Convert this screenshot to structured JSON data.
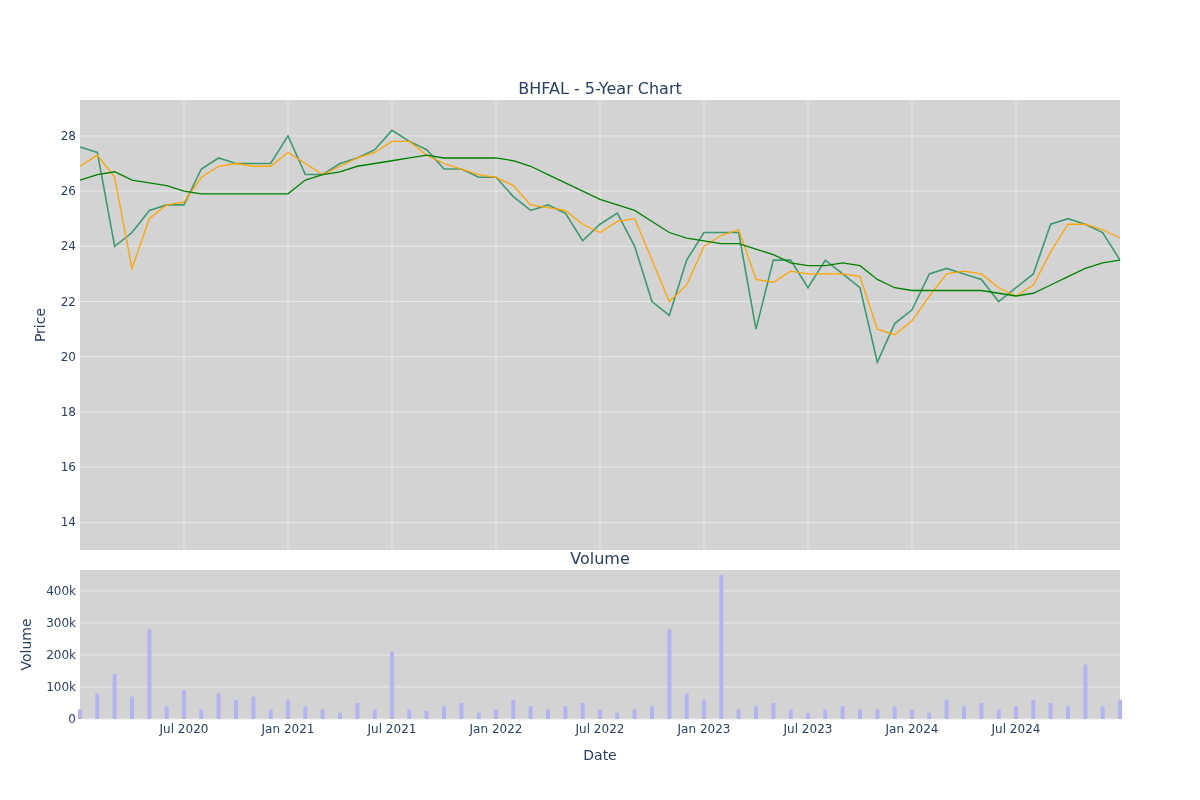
{
  "title": "BHFAL - 5-Year Chart",
  "price_chart": {
    "chart_data": {
      "type": "line",
      "ylabel": "Price",
      "grid": true,
      "ylim": [
        13,
        29.3
      ],
      "yticks": [
        {
          "value": 14,
          "label": "14"
        },
        {
          "value": 16,
          "label": "16"
        },
        {
          "value": 18,
          "label": "18"
        },
        {
          "value": 20,
          "label": "20"
        },
        {
          "value": 22,
          "label": "22"
        },
        {
          "value": 24,
          "label": "24"
        },
        {
          "value": 26,
          "label": "26"
        },
        {
          "value": 28,
          "label": "28"
        }
      ],
      "categories": [
        null,
        null,
        null,
        null,
        null,
        null,
        null,
        null,
        null,
        null,
        null,
        null,
        null,
        null,
        null,
        null,
        null,
        null,
        null,
        null,
        null,
        null,
        null,
        null,
        null,
        null,
        null,
        null,
        null,
        null,
        null,
        null,
        null,
        null,
        null,
        null,
        null,
        null,
        null,
        null,
        null,
        null,
        null,
        null,
        null,
        null,
        null,
        null,
        null,
        null,
        null,
        null,
        null,
        null,
        null,
        null,
        null,
        null,
        null,
        null,
        null
      ],
      "series": [
        {
          "color": "#3d9970",
          "values": [
            27.6,
            27.4,
            24,
            24.5,
            25.3,
            25.5,
            25.5,
            26.8,
            27.2,
            27,
            27,
            27,
            28,
            26.6,
            26.6,
            27,
            27.2,
            27.5,
            28.2,
            27.8,
            27.5,
            26.8,
            26.8,
            26.5,
            26.5,
            25.8,
            25.3,
            25.5,
            25.2,
            24.2,
            24.8,
            25.2,
            24,
            22,
            21.5,
            23.5,
            24.5,
            24.5,
            24.5,
            21,
            23.5,
            23.5,
            22.5,
            23.5,
            23,
            22.5,
            19.8,
            21.2,
            21.7,
            23,
            23.2,
            23,
            22.8,
            22,
            22.5,
            23,
            24.8,
            25,
            24.8,
            24.5,
            23.5
          ]
        },
        {
          "color": "#ffa500",
          "values": [
            26.9,
            27.3,
            26.5,
            23.2,
            25,
            25.5,
            25.6,
            26.5,
            26.9,
            27,
            26.9,
            26.9,
            27.4,
            27,
            26.6,
            26.9,
            27.2,
            27.4,
            27.8,
            27.8,
            27.3,
            27,
            26.8,
            26.6,
            26.5,
            26.2,
            25.5,
            25.4,
            25.3,
            24.8,
            24.5,
            24.9,
            25,
            23.5,
            22,
            22.6,
            24,
            24.4,
            24.6,
            22.8,
            22.7,
            23.1,
            23,
            23,
            23,
            22.9,
            21,
            20.8,
            21.3,
            22.2,
            23,
            23.1,
            23,
            22.5,
            22.2,
            22.6,
            23.8,
            24.8,
            24.8,
            24.6,
            24.3
          ]
        },
        {
          "color": "#008000",
          "values": [
            26.4,
            26.6,
            26.7,
            26.4,
            26.3,
            26.2,
            26,
            25.9,
            25.9,
            25.9,
            25.9,
            25.9,
            25.9,
            26.4,
            26.6,
            26.7,
            26.9,
            27,
            27.1,
            27.2,
            27.3,
            27.2,
            27.2,
            27.2,
            27.2,
            27.1,
            26.9,
            26.6,
            26.3,
            26,
            25.7,
            25.5,
            25.3,
            24.9,
            24.5,
            24.3,
            24.2,
            24.1,
            24.1,
            23.9,
            23.7,
            23.4,
            23.3,
            23.3,
            23.4,
            23.3,
            22.8,
            22.5,
            22.4,
            22.4,
            22.4,
            22.4,
            22.4,
            22.3,
            22.2,
            22.3,
            22.6,
            22.9,
            23.2,
            23.4,
            23.5
          ]
        }
      ]
    }
  },
  "volume_chart": {
    "chart_data": {
      "type": "bar",
      "title": "Volume",
      "xlabel": "Date",
      "ylabel": "Volume",
      "grid": true,
      "ylim": [
        0,
        465000
      ],
      "yticks": [
        {
          "value": 0,
          "label": "0"
        },
        {
          "value": 100000,
          "label": "100k"
        },
        {
          "value": 200000,
          "label": "200k"
        },
        {
          "value": 300000,
          "label": "300k"
        },
        {
          "value": 400000,
          "label": "400k"
        }
      ],
      "categories": [
        null,
        null,
        null,
        null,
        null,
        null,
        "Jul 2020",
        null,
        null,
        null,
        null,
        null,
        "Jan 2021",
        null,
        null,
        null,
        null,
        null,
        "Jul 2021",
        null,
        null,
        null,
        null,
        null,
        "Jan 2022",
        null,
        null,
        null,
        null,
        null,
        "Jul 2022",
        null,
        null,
        null,
        null,
        null,
        "Jan 2023",
        null,
        null,
        null,
        null,
        null,
        "Jul 2023",
        null,
        null,
        null,
        null,
        null,
        "Jan 2024",
        null,
        null,
        null,
        null,
        null,
        "Jul 2024",
        null,
        null,
        null,
        null,
        null,
        null
      ],
      "series": [
        {
          "color": "#b4b4f0",
          "values": [
            30000,
            80000,
            140000,
            70000,
            280000,
            40000,
            90000,
            30000,
            80000,
            60000,
            70000,
            30000,
            60000,
            40000,
            30000,
            20000,
            50000,
            30000,
            210000,
            30000,
            25000,
            40000,
            50000,
            20000,
            30000,
            60000,
            40000,
            30000,
            40000,
            50000,
            30000,
            20000,
            30000,
            40000,
            280000,
            80000,
            60000,
            450000,
            30000,
            40000,
            50000,
            30000,
            20000,
            30000,
            40000,
            30000,
            30000,
            40000,
            30000,
            20000,
            60000,
            40000,
            50000,
            30000,
            40000,
            60000,
            50000,
            40000,
            170000,
            40000,
            60000
          ]
        }
      ]
    }
  }
}
